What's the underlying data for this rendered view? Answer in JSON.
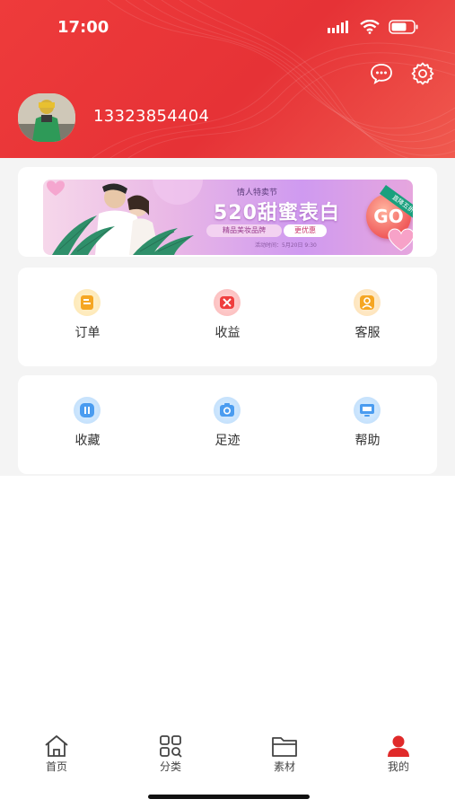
{
  "status_bar": {
    "time": "17:00"
  },
  "profile": {
    "phone": "13323854404"
  },
  "banner": {
    "subtitle": "情人特卖节",
    "title": "520甜蜜表白",
    "tag_brand": "精品美妆品牌",
    "tag_discount": "更优惠",
    "activity_time": "活动时间：5月20日 9:30",
    "go_label": "GO",
    "corner_label": "直降五折"
  },
  "menu_group_1": [
    {
      "label": "订单",
      "icon": "order-icon",
      "color": "#f5a623"
    },
    {
      "label": "收益",
      "icon": "earnings-icon",
      "color": "#ef3e3e"
    },
    {
      "label": "客服",
      "icon": "customer-service-icon",
      "color": "#f5a623"
    }
  ],
  "menu_group_2": [
    {
      "label": "收藏",
      "icon": "favorites-icon",
      "color": "#4a9cf0"
    },
    {
      "label": "足迹",
      "icon": "footprint-icon",
      "color": "#4a9cf0"
    },
    {
      "label": "帮助",
      "icon": "help-icon",
      "color": "#4a9cf0"
    }
  ],
  "tabbar": [
    {
      "label": "首页",
      "icon": "home-icon"
    },
    {
      "label": "分类",
      "icon": "category-icon"
    },
    {
      "label": "素材",
      "icon": "folder-icon"
    },
    {
      "label": "我的",
      "icon": "profile-icon",
      "active": true
    }
  ],
  "colors": {
    "header": "#e63236",
    "accent": "#e02a2a",
    "background": "#f4f4f4"
  }
}
